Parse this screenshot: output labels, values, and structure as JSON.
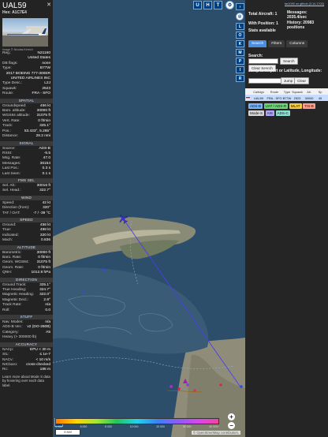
{
  "aircraft": {
    "callsign": "UAL59",
    "hex_label": "Hex:",
    "hex": "A1C7E4",
    "photo_credit": "Image © Nicolas Kerrich"
  },
  "info": [
    {
      "k": "Reg.:",
      "v": "N21160"
    },
    {
      "k": "",
      "v": "United States"
    },
    {
      "k": "DB flags:",
      "v": "none"
    },
    {
      "k": "Type:",
      "v": "B77W"
    },
    {
      "k": "",
      "v": "2017 BOEING 777-300ER"
    },
    {
      "k": "",
      "v": "UNITED AIRLINES INC"
    },
    {
      "k": "Type Desc.:",
      "v": "L2J"
    },
    {
      "k": "Squawk:",
      "v": "2523"
    },
    {
      "k": "Route:",
      "v": "FRA - SFO"
    }
  ],
  "sections": [
    {
      "title": "SPATIAL",
      "rows": [
        {
          "k": "Groundspeed:",
          "v": "456 kt"
        },
        {
          "k": "Baro. altitude:",
          "v": "30000 ft"
        },
        {
          "k": "WGS84 altitude:",
          "v": "31075 ft"
        },
        {
          "k": "Vert. Rate:",
          "v": "0 ft/min"
        },
        {
          "k": "Track:",
          "v": "325.1°"
        },
        {
          "k": "Pos.:",
          "v": "53.433°, 5.265°"
        },
        {
          "k": "Distance:",
          "v": "28.2 nmi"
        }
      ]
    },
    {
      "title": "SIGNAL",
      "rows": [
        {
          "k": "Source:",
          "v": "ADS-B"
        },
        {
          "k": "RSSI:",
          "v": "-5.5"
        },
        {
          "k": "Msg. Rate:",
          "v": "47.0"
        },
        {
          "k": "Messages:",
          "v": "36154"
        },
        {
          "k": "",
          "v": ""
        },
        {
          "k": "Last Pos.:",
          "v": "0.3 s"
        },
        {
          "k": "Last Seen:",
          "v": "0.1 s"
        }
      ]
    },
    {
      "title": "FMS SEL",
      "rows": [
        {
          "k": "Sel. Alt.:",
          "v": "30016 ft"
        },
        {
          "k": "Sel. Head.:",
          "v": "322.7°"
        }
      ]
    },
    {
      "title": "WIND",
      "rows": [
        {
          "k": "Speed:",
          "v": "42 kt"
        },
        {
          "k": "Direction (from):",
          "v": "320°"
        },
        {
          "k": "TAT / OAT:",
          "v": "-7 / -39 °C"
        }
      ]
    },
    {
      "title": "SPEED",
      "rows": [
        {
          "k": "Ground:",
          "v": "456 kt"
        },
        {
          "k": "True:",
          "v": "498 kt"
        },
        {
          "k": "Indicated:",
          "v": "320 kt"
        },
        {
          "k": "Mach:",
          "v": "0.836"
        }
      ]
    },
    {
      "title": "ALTITUDE",
      "rows": [
        {
          "k": "Barometric:",
          "v": "30000 ft"
        },
        {
          "k": "Baro. Rate:",
          "v": "0 ft/min"
        },
        {
          "k": "Geom. WGS84:",
          "v": "31075 ft"
        },
        {
          "k": "Geom. Rate:",
          "v": "0 ft/min"
        },
        {
          "k": "QNH:",
          "v": "1012.8 hPa"
        }
      ]
    },
    {
      "title": "DIRECTION",
      "rows": [
        {
          "k": "Ground Track:",
          "v": "325.1°"
        },
        {
          "k": "True Heading:",
          "v": "324.7°"
        },
        {
          "k": "Magnetic Heading:",
          "v": "322.0°"
        },
        {
          "k": "Magnetic Decl.:",
          "v": "2.8°"
        },
        {
          "k": "Track Rate:",
          "v": "n/a"
        },
        {
          "k": "Roll:",
          "v": "0.0"
        }
      ]
    },
    {
      "title": "STUFF",
      "rows": [
        {
          "k": "Nav. Modes:",
          "v": "n/a"
        },
        {
          "k": "ADS-B Ver.:",
          "v": "v2 (DO-260B)"
        },
        {
          "k": "Category:",
          "v": "A5"
        },
        {
          "k": "Heavy (> 300000 lb)",
          "v": ""
        }
      ]
    },
    {
      "title": "ACCURACY",
      "rows": [
        {
          "k": "NACp:",
          "v": "EPU < 30 m"
        },
        {
          "k": "SIL:",
          "v": "≤ 1e-7"
        },
        {
          "k": "NACv:",
          "v": "< 10 m/s"
        },
        {
          "k": "NICbaro:",
          "v": "cross-checked"
        },
        {
          "k": "Rc:",
          "v": "186 m"
        }
      ]
    }
  ],
  "learn_more": "Learn more about Mode S data by hovering over each data label.",
  "map": {
    "top_buttons": [
      "U",
      "H",
      "T"
    ],
    "side_buttons": [
      "L",
      "O",
      "K",
      "M",
      "P",
      "I",
      "R"
    ],
    "zoom_in": "+",
    "zoom_out": "−",
    "scale": "5 NM",
    "alt_ticks": [
      "4 000",
      "6 000",
      "8 000",
      "10 000",
      "20 000",
      "30 000",
      "40 000+"
    ],
    "attribution": "© OpenStreetMap contributors."
  },
  "right": {
    "link": "tar1090 on github (3.14.1700)",
    "total_aircraft": "Total Aircraft: 1",
    "with_position": "With Position: 1",
    "messages": "Messages: 2035.4/sec",
    "history": "History: 20983 positions",
    "stats": "Stats available",
    "tabs": [
      "Search",
      "Filters",
      "Columns"
    ],
    "search_label": "Search:",
    "search_button": "Search",
    "clear_search": "Clear Search",
    "jump_label": "Jump to Airport or Latitude, Longitude:",
    "jump_button": "Jump",
    "clear_button": "Clear",
    "columns": [
      "",
      "Callsign",
      "Route",
      "Type",
      "Squawk",
      "Alt.",
      "Sp"
    ],
    "row": [
      "",
      "UAL59",
      "FRA - SFO",
      "B77W",
      "2523",
      "30000",
      "45"
    ],
    "tags": [
      "ADS-B",
      "UAT / ADS-R",
      "MLAT",
      "TIS-B",
      "Mode-S",
      "AIS",
      "ADS-C"
    ]
  }
}
